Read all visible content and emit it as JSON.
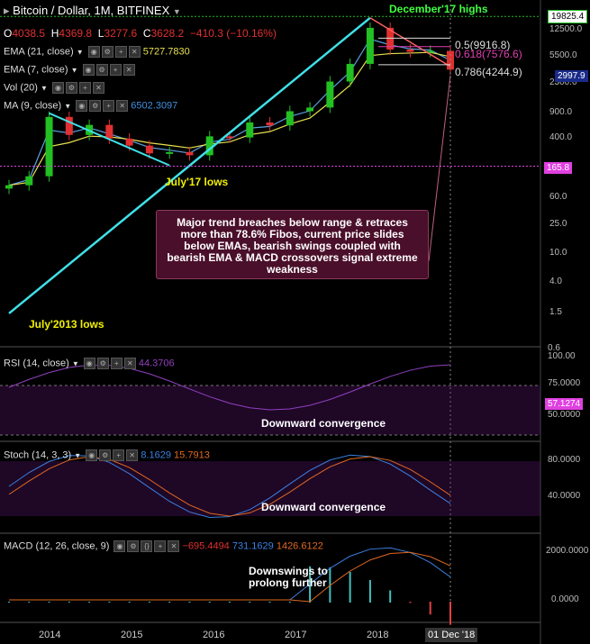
{
  "header": {
    "title": "Bitcoin / Dollar, 1M, BITFINEX",
    "ohlc": {
      "o": "4038.5",
      "h": "4369.8",
      "l": "3277.6",
      "c": "3628.2",
      "change": "−410.3 (−10.16%)"
    },
    "ema21": {
      "label": "EMA (21, close)",
      "value": "5727.7830"
    },
    "ema7": {
      "label": "EMA (7, close)"
    },
    "vol": {
      "label": "Vol (20)"
    },
    "ma": {
      "label": "MA (9, close)",
      "value": "6502.3097"
    }
  },
  "price_axis": {
    "ticks": [
      "12500.0",
      "5500.0",
      "2300.0",
      "900.0",
      "400.0",
      "160.0",
      "60.0",
      "25.0",
      "10.0",
      "4.0",
      "1.5"
    ],
    "high_tag": "19825.4",
    "last_tag": "2997.9",
    "low_tag": "165.8",
    "bottom_tag": "0.6"
  },
  "fibs": [
    {
      "label": "0.5(9916.8)",
      "color": "#dddddd"
    },
    {
      "label": "0.618(7576.6)",
      "color": "#e040b0"
    },
    {
      "label": "0.786(4244.9)",
      "color": "#dddddd"
    }
  ],
  "annotations": {
    "dec17": "December'17 highs",
    "jul17": "July'17 lows",
    "jul13": "July'2013 lows",
    "callout": "Major trend breaches below range & retraces more than 78.6% Fibos, current price slides below EMAs, bearish swings coupled with bearish EMA & MACD crossovers signal extreme weakness",
    "rsi_note": "Downward convergence",
    "stoch_note": "Downward convergence",
    "macd_note": "Downswings to prolong further"
  },
  "rsi": {
    "label": "RSI (14, close)",
    "value": "44.3706",
    "ticks": [
      "100.00",
      "75.0000",
      "50.0000"
    ],
    "tag": "57.1274"
  },
  "stoch": {
    "label": "Stoch (14, 3, 3)",
    "k": "8.1629",
    "d": "15.7913",
    "ticks": [
      "80.0000",
      "40.0000"
    ]
  },
  "macd": {
    "label": "MACD (12, 26, close, 9)",
    "hist": "−695.4494",
    "macd": "731.1629",
    "signal": "1426.6122",
    "ticks": [
      "2000.0000",
      "0.0000"
    ]
  },
  "time_axis": {
    "labels": [
      "2014",
      "2015",
      "2016",
      "2017",
      "2018"
    ],
    "cursor_label": "01 Dec '18"
  },
  "colors": {
    "up": "#22c022",
    "down": "#e03030",
    "ema7": "#5aa0e0",
    "ema21": "#e8e050",
    "ma": "#4090e0",
    "trend": "#40e0e8",
    "rsi": "#9040c0",
    "stoch_k": "#3a80e0",
    "stoch_d": "#e06820"
  },
  "chart_data": {
    "type": "line",
    "title": "Bitcoin / Dollar, 1M, BITFINEX",
    "xlabel": "",
    "ylabel": "",
    "log_scale": true,
    "x": [
      "2013-06",
      "2013-09",
      "2013-12",
      "2014-03",
      "2014-06",
      "2014-09",
      "2014-12",
      "2015-03",
      "2015-06",
      "2015-09",
      "2015-12",
      "2016-03",
      "2016-06",
      "2016-09",
      "2016-12",
      "2017-03",
      "2017-06",
      "2017-09",
      "2017-12",
      "2018-03",
      "2018-06",
      "2018-09",
      "2018-12"
    ],
    "series": [
      {
        "name": "close",
        "values": [
          90,
          120,
          800,
          450,
          620,
          400,
          320,
          250,
          260,
          235,
          430,
          415,
          670,
          610,
          960,
          1080,
          2480,
          4360,
          13800,
          6900,
          6400,
          6600,
          3628
        ]
      }
    ],
    "ylim": [
      1,
      20000
    ],
    "key_levels": {
      "dec17_high": 19825.4,
      "fib_0_5": 9916.8,
      "fib_0_618": 7576.6,
      "fib_0_786": 4244.9,
      "jul17_low": 165.8
    }
  }
}
